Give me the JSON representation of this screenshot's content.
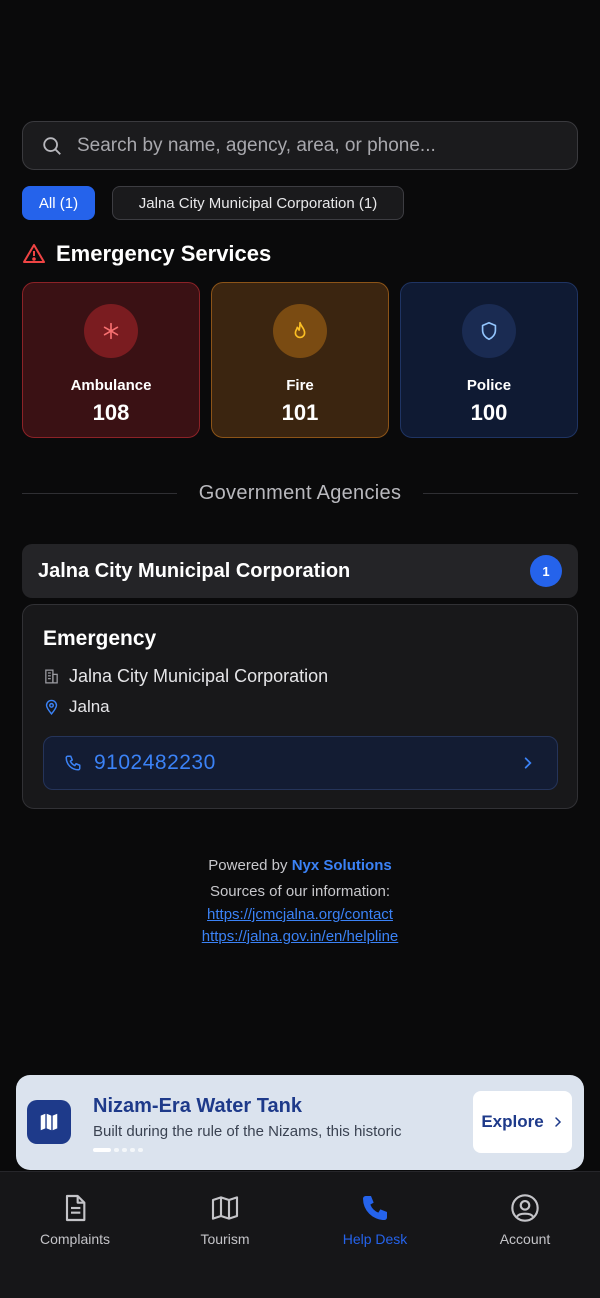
{
  "search": {
    "placeholder": "Search by name, agency, area, or phone..."
  },
  "filters": [
    {
      "label": "All (1)",
      "active": true
    },
    {
      "label": "Jalna City Municipal Corporation (1)",
      "active": false
    }
  ],
  "emergency": {
    "title": "Emergency Services",
    "services": [
      {
        "label": "Ambulance",
        "number": "108",
        "icon": "medical-asterisk-icon",
        "color": "#dc2626"
      },
      {
        "label": "Fire",
        "number": "101",
        "icon": "flame-icon",
        "color": "#f59e0b"
      },
      {
        "label": "Police",
        "number": "100",
        "icon": "shield-icon",
        "color": "#3b82f6"
      }
    ]
  },
  "agencies": {
    "divider_label": "Government Agencies",
    "groups": [
      {
        "name": "Jalna City Municipal Corporation",
        "count": "1",
        "contacts": [
          {
            "title": "Emergency",
            "organization": "Jalna City Municipal Corporation",
            "location": "Jalna",
            "phone": "9102482230"
          }
        ]
      }
    ]
  },
  "footer": {
    "powered_prefix": "Powered by",
    "powered_brand": "Nyx Solutions",
    "sources_label": "Sources of our information:",
    "links": [
      "https://jcmcjalna.org/contact",
      "https://jalna.gov.in/en/helpline"
    ]
  },
  "banner": {
    "title": "Nizam-Era Water Tank",
    "subtitle": "Built during the rule of the Nizams, this historic",
    "button": "Explore",
    "slides": 5,
    "active_slide": 0
  },
  "nav": [
    {
      "label": "Complaints",
      "icon": "document-icon",
      "active": false
    },
    {
      "label": "Tourism",
      "icon": "map-icon",
      "active": false
    },
    {
      "label": "Help Desk",
      "icon": "phone-icon",
      "active": true
    },
    {
      "label": "Account",
      "icon": "user-circle-icon",
      "active": false
    }
  ],
  "colors": {
    "accent": "#2563eb",
    "link": "#3b82f6",
    "background": "#0a0a0b"
  }
}
